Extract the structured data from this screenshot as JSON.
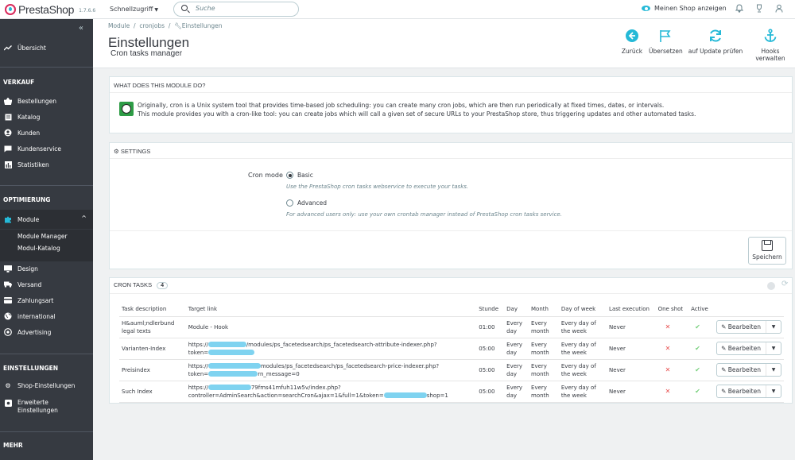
{
  "topbar": {
    "logo": "PrestaShop",
    "version": "1.7.6.6",
    "quick_access": "Schnellzugriff",
    "search_placeholder": "Suche",
    "show_shop": "Meinen Shop anzeigen"
  },
  "sidebar": {
    "overview": "Übersicht",
    "sections": [
      {
        "title": "VERKAUF",
        "items": [
          "Bestellungen",
          "Katalog",
          "Kunden",
          "Kundenservice",
          "Statistiken"
        ]
      },
      {
        "title": "OPTIMIERUNG",
        "items": [
          "Module",
          "Design",
          "Versand",
          "Zahlungsart",
          "International",
          "Advertising"
        ]
      },
      {
        "title": "EINSTELLUNGEN",
        "items": [
          "Shop-Einstellungen",
          "Erweiterte Einstellungen"
        ]
      },
      {
        "title": "MEHR"
      }
    ],
    "module_sub": [
      "Module Manager",
      "Modul-Katalog"
    ],
    "advanced_line1": "Erweiterte",
    "advanced_line2": "Einstellungen"
  },
  "header": {
    "breadcrumb": [
      "Module",
      "cronjobs",
      "Einstellungen"
    ],
    "title": "Einstellungen",
    "subtitle": "Cron tasks manager",
    "toolbar": [
      "Zurück",
      "Übersetzen",
      "auf Update prüfen",
      "Hooks verwalten"
    ]
  },
  "about": {
    "title": "WHAT DOES THIS MODULE DO?",
    "line1": "Originally, cron is a Unix system tool that provides time-based job scheduling: you can create many cron jobs, which are then run periodically at fixed times, dates, or intervals.",
    "line2": "This module provides you with a cron-like tool: you can create jobs which will call a given set of secure URLs to your PrestaShop store, thus triggering updates and other automated tasks."
  },
  "settings": {
    "title": "SETTINGS",
    "cron_mode_label": "Cron mode",
    "basic": "Basic",
    "basic_help": "Use the PrestaShop cron tasks webservice to execute your tasks.",
    "advanced": "Advanced",
    "advanced_help": "For advanced users only: use your own crontab manager instead of PrestaShop cron tasks service.",
    "selected": "Basic",
    "save": "Speichern"
  },
  "cron_tasks": {
    "title": "CRON TASKS",
    "count": "4",
    "columns": [
      "Task description",
      "Target link",
      "Stunde",
      "Day",
      "Month",
      "Day of week",
      "Last execution",
      "One shot",
      "Active",
      ""
    ],
    "edit_label": "Bearbeiten",
    "rows": [
      {
        "desc": [
          "H&auml;ndlerbund",
          "legal texts"
        ],
        "link": [
          "Module - Hook"
        ],
        "hour": "01:00",
        "day": [
          "Every",
          "day"
        ],
        "month": [
          "Every",
          "month"
        ],
        "dow": [
          "Every day of",
          "the week"
        ],
        "last": "Never"
      },
      {
        "desc": [
          "Varianten-Index"
        ],
        "link": [
          "https://",
          "/modules/ps_facetedsearch/ps_facetedsearch-attribute-indexer.php?",
          "token="
        ],
        "hour": "05:00",
        "day": [
          "Every",
          "day"
        ],
        "month": [
          "Every",
          "month"
        ],
        "dow": [
          "Every day of",
          "the week"
        ],
        "last": "Never"
      },
      {
        "desc": [
          "Preisindex"
        ],
        "link": [
          "https://",
          "modules/ps_facetedsearch/ps_facetedsearch-price-indexer.php?",
          "token=",
          "rn_message=0"
        ],
        "hour": "05:00",
        "day": [
          "Every",
          "day"
        ],
        "month": [
          "Every",
          "month"
        ],
        "dow": [
          "Every day of",
          "the week"
        ],
        "last": "Never"
      },
      {
        "desc": [
          "Such Index"
        ],
        "link": [
          "https://",
          "79fms41mfuh11w5v/index.php?",
          "controller=AdminSearch&action=searchCron&ajax=1&full=1&token=",
          "shop=1"
        ],
        "hour": "05:00",
        "day": [
          "Every",
          "day"
        ],
        "month": [
          "Every",
          "month"
        ],
        "dow": [
          "Every day of",
          "the week"
        ],
        "last": "Never"
      }
    ]
  }
}
